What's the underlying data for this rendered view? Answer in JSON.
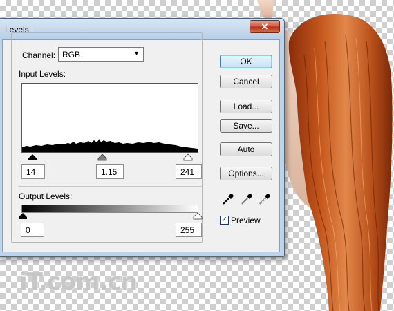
{
  "dialog": {
    "title": "Levels",
    "close_glyph": "✕",
    "channel_label": "Channel:",
    "channel_value": "RGB",
    "input_levels_label": "Input Levels:",
    "input_black": "14",
    "input_gamma": "1.15",
    "input_white": "241",
    "output_levels_label": "Output Levels:",
    "output_black": "0",
    "output_white": "255",
    "buttons": {
      "ok": "OK",
      "cancel": "Cancel",
      "load": "Load...",
      "save": "Save...",
      "auto": "Auto",
      "options": "Options..."
    },
    "preview_label": "Preview",
    "preview_checked": true
  },
  "icons": {
    "eyedroppers": [
      "black-point-eyedropper-icon",
      "gray-point-eyedropper-icon",
      "white-point-eyedropper-icon"
    ]
  },
  "watermark": "iT.com.cn"
}
